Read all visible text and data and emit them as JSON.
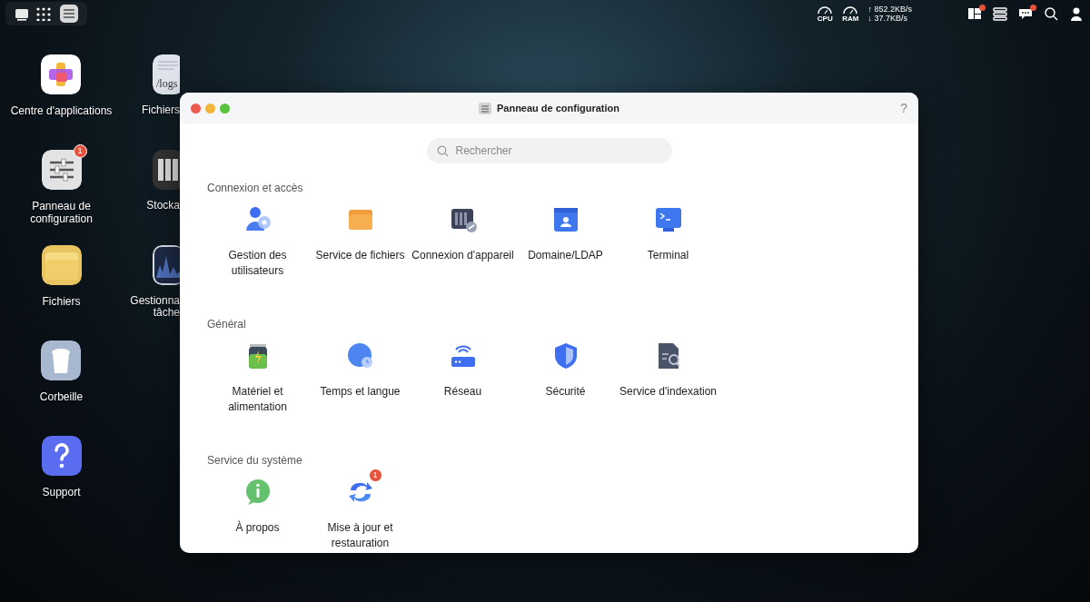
{
  "top_bar": {
    "cpu_label": "CPU",
    "ram_label": "RAM",
    "upload": "↑ 852.2KB/s",
    "download": "↓ 37.7KB/s",
    "widgets_alert": true,
    "messages_alert": true
  },
  "desktop": {
    "column_1": [
      {
        "label": "Centre d'applications"
      },
      {
        "label": "Panneau de configuration",
        "badge": "1"
      },
      {
        "label": "Fichiers"
      },
      {
        "label": "Corbeille"
      },
      {
        "label": "Support"
      }
    ],
    "column_2": [
      {
        "label": "Fichiers",
        "icon_text": "/logs"
      },
      {
        "label": "Stocka"
      },
      {
        "label": "Gestionna tâche"
      }
    ]
  },
  "window": {
    "title": "Panneau de configuration",
    "help": "?",
    "search": {
      "placeholder": "Rechercher"
    },
    "sections": [
      {
        "title": "Connexion et accès",
        "items": [
          {
            "label": "Gestion des utilisateurs"
          },
          {
            "label": "Service de fichiers"
          },
          {
            "label": "Connexion d'appareil"
          },
          {
            "label": "Domaine/LDAP"
          },
          {
            "label": "Terminal"
          }
        ]
      },
      {
        "title": "Général",
        "items": [
          {
            "label": "Matériel et alimentation"
          },
          {
            "label": "Temps et langue"
          },
          {
            "label": "Réseau"
          },
          {
            "label": "Sécurité"
          },
          {
            "label": "Service d'indexation"
          }
        ]
      },
      {
        "title": "Service du système",
        "items": [
          {
            "label": "À propos"
          },
          {
            "label": "Mise à jour et restauration",
            "badge": "1"
          }
        ]
      }
    ]
  }
}
